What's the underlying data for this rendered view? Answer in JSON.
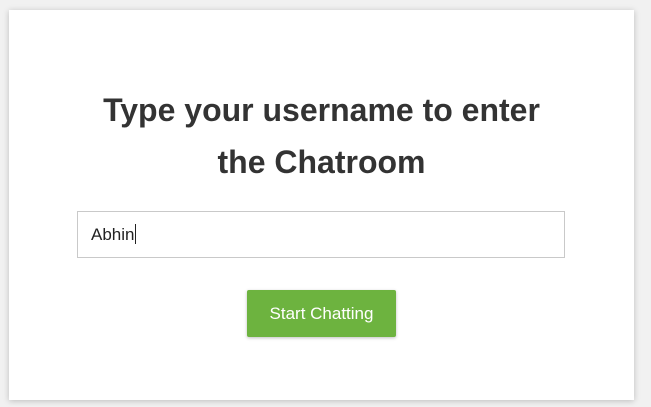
{
  "login": {
    "title_line1": "Type your username to enter",
    "title_line2": "the Chatroom",
    "username_value": "Abhin",
    "button_label": "Start Chatting",
    "accent_color": "#6db33f"
  }
}
